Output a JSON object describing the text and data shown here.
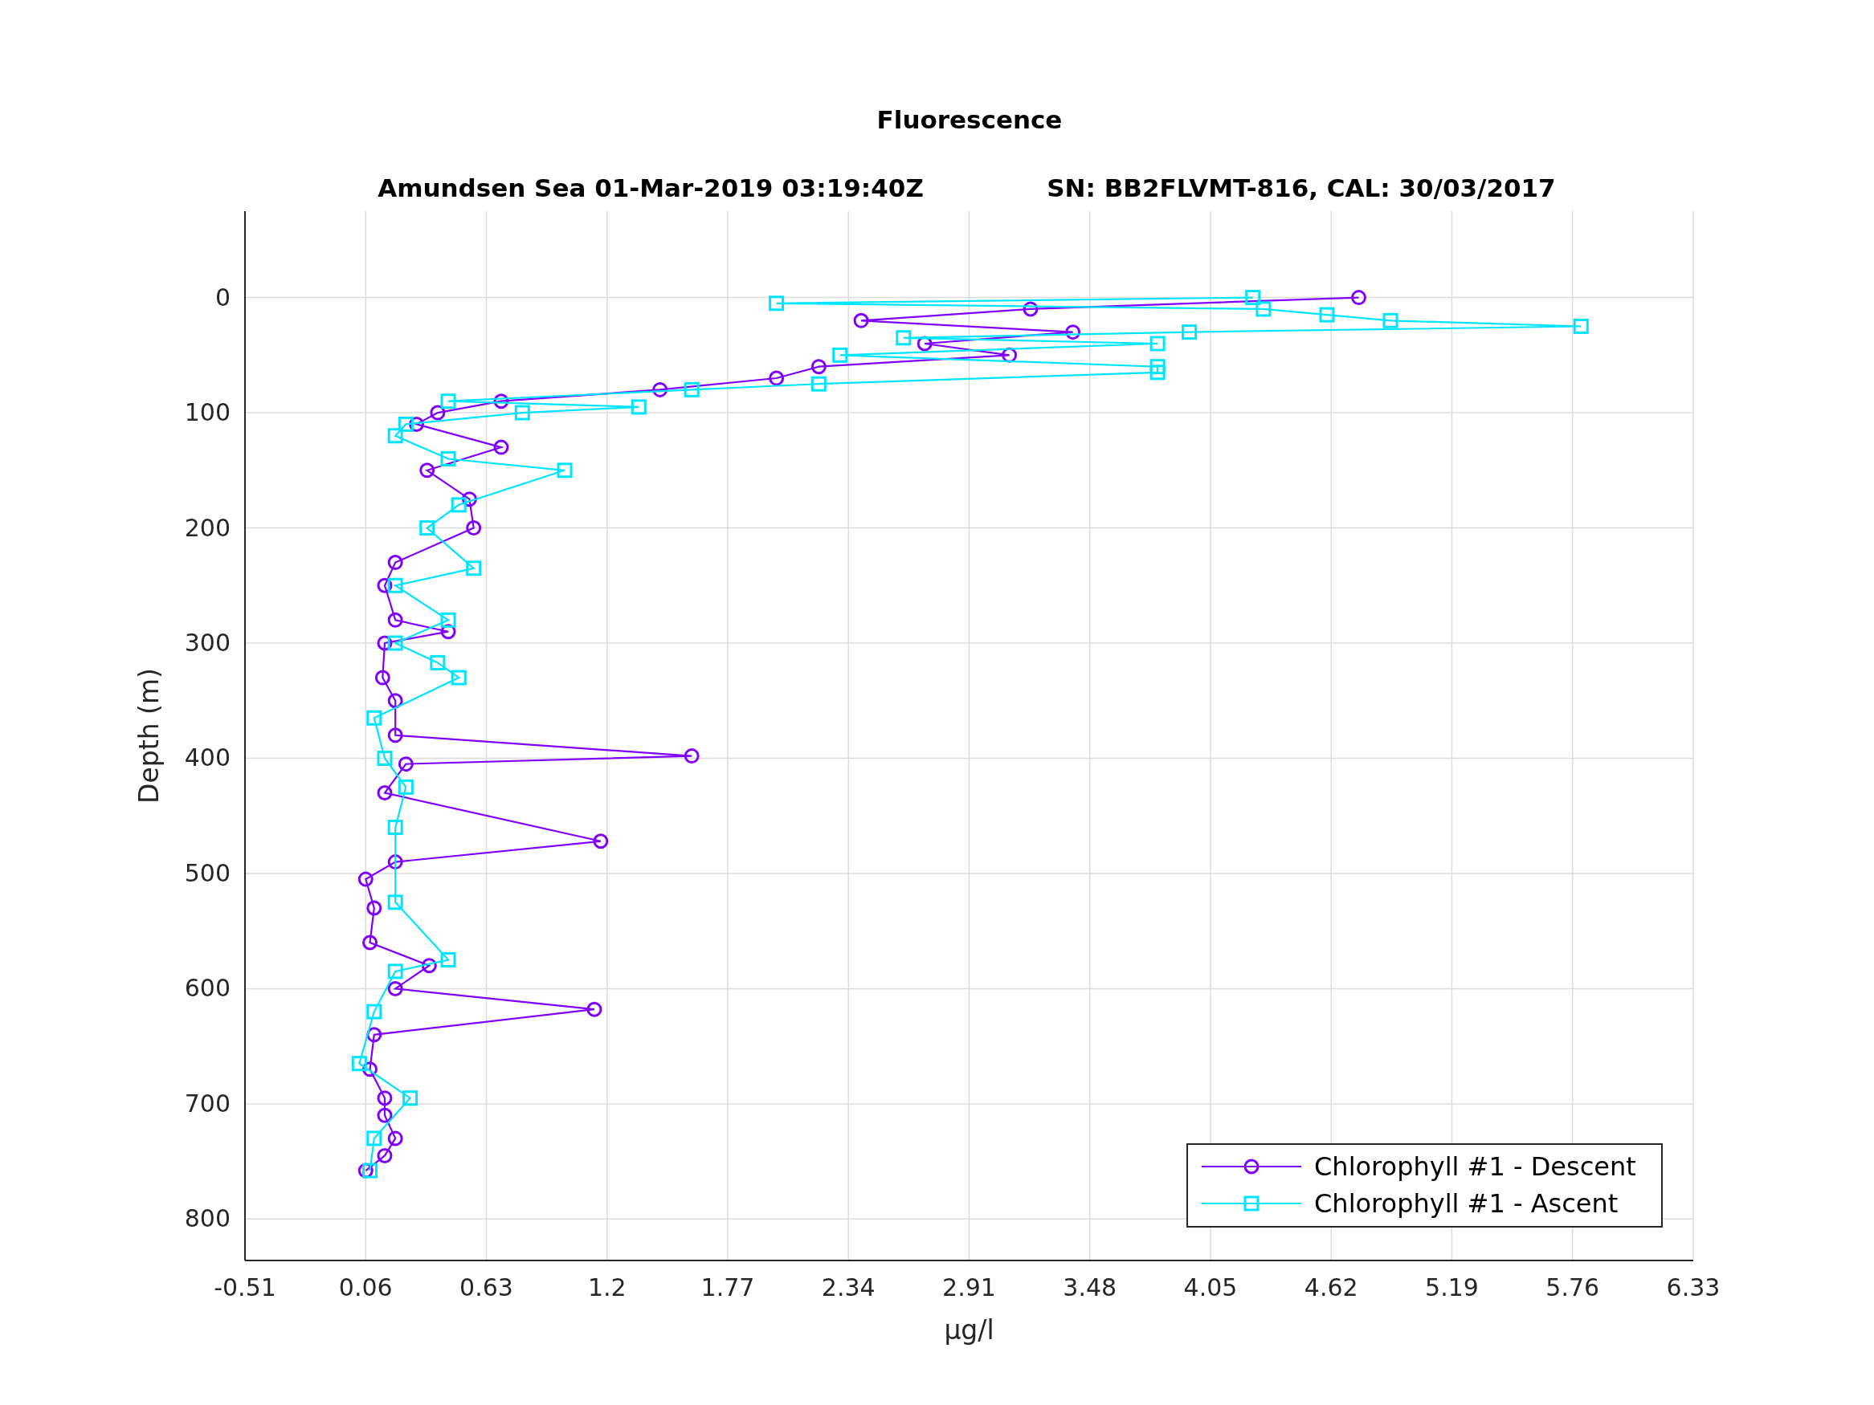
{
  "figure": {
    "title": "Fluorescence",
    "subtitle_left": "Amundsen Sea 01-Mar-2019 03:19:40Z",
    "subtitle_right": "SN: BB2FLVMT-816, CAL: 30/03/2017",
    "chart_data": {
      "type": "line",
      "orientation": "horizontal",
      "grid": true,
      "legend": true,
      "xlabel": "μg/l",
      "ylabel": "Depth (m)",
      "xlim": [
        -0.51,
        6.33
      ],
      "ylim": [
        836,
        -75
      ],
      "xticks": [
        -0.51,
        0.06,
        0.63,
        1.2,
        1.77,
        2.34,
        2.91,
        3.48,
        4.05,
        4.62,
        5.19,
        5.76,
        6.33
      ],
      "yticks": [
        0,
        100,
        200,
        300,
        400,
        500,
        600,
        700,
        800
      ],
      "series": [
        {
          "name": "Chlorophyll #1 - Descent",
          "color": "#8000ff",
          "marker": "circle",
          "x": [
            0,
            10,
            20,
            30,
            40,
            50,
            60,
            70,
            80,
            90,
            100,
            110,
            130,
            150,
            175,
            200,
            230,
            250,
            280,
            290,
            300,
            330,
            350,
            380,
            398,
            405,
            430,
            472,
            490,
            505,
            530,
            560,
            580,
            600,
            618,
            640,
            670,
            695,
            710,
            730,
            745,
            758
          ],
          "values": [
            4.75,
            3.2,
            2.4,
            3.4,
            2.7,
            3.1,
            2.2,
            2.0,
            1.45,
            0.7,
            0.4,
            0.3,
            0.7,
            0.35,
            0.55,
            0.57,
            0.2,
            0.15,
            0.2,
            0.45,
            0.15,
            0.14,
            0.2,
            0.2,
            1.6,
            0.25,
            0.15,
            1.17,
            0.2,
            0.06,
            0.1,
            0.08,
            0.36,
            0.2,
            1.14,
            0.1,
            0.08,
            0.15,
            0.15,
            0.2,
            0.15,
            0.06
          ]
        },
        {
          "name": "Chlorophyll #1 - Ascent",
          "color": "#00e5ff",
          "marker": "square",
          "x": [
            0,
            5,
            10,
            15,
            20,
            25,
            30,
            35,
            40,
            50,
            60,
            65,
            75,
            80,
            90,
            95,
            100,
            110,
            120,
            140,
            150,
            180,
            200,
            235,
            250,
            280,
            300,
            317,
            330,
            365,
            400,
            425,
            460,
            525,
            575,
            585,
            620,
            665,
            695,
            730,
            758
          ],
          "values": [
            4.25,
            2.0,
            4.3,
            4.6,
            4.9,
            5.8,
            3.95,
            2.6,
            3.8,
            2.3,
            3.8,
            3.8,
            2.2,
            1.6,
            0.45,
            1.35,
            0.8,
            0.25,
            0.2,
            0.45,
            1.0,
            0.5,
            0.35,
            0.57,
            0.2,
            0.45,
            0.2,
            0.4,
            0.5,
            0.1,
            0.15,
            0.25,
            0.2,
            0.2,
            0.45,
            0.2,
            0.1,
            0.03,
            0.27,
            0.1,
            0.08
          ]
        }
      ]
    }
  }
}
